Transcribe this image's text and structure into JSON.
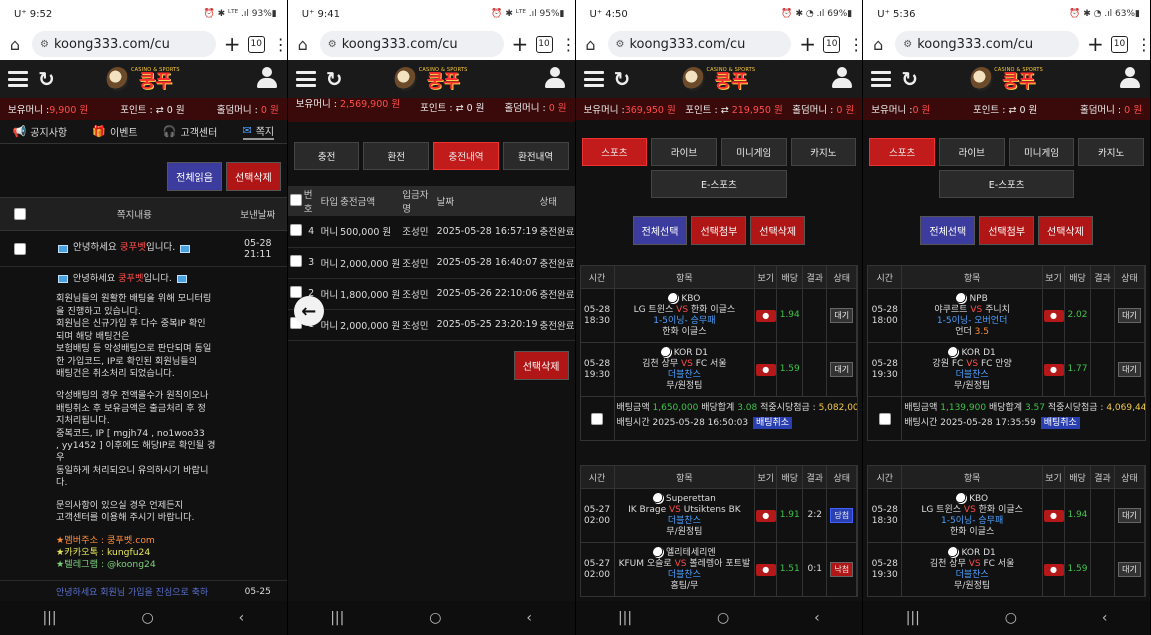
{
  "common": {
    "url": "koong333.com/cu",
    "tab_count": "10",
    "logo_small": "CASINO & SPORTS",
    "logo_big": "쿵푸",
    "labels": {
      "balance": "보유머니 :",
      "point": "포인트 :",
      "hold": "홀덤머니 :"
    },
    "point_icon": "⇄",
    "hold_value": "0 원"
  },
  "phones": [
    {
      "status": {
        "carrier": "U⁺",
        "time": "9:52",
        "right": "⏰ ✱ ᴸᵀᴱ .ıl 93%▮"
      },
      "balance": "9,900 원",
      "point": "0 원",
      "nav": [
        {
          "icon": "📢",
          "label": "공지사항"
        },
        {
          "icon": "🎁",
          "label": "이벤트"
        },
        {
          "icon": "🎧",
          "label": "고객센터"
        },
        {
          "icon": "✉",
          "label": "쪽지"
        }
      ],
      "buttons": {
        "read_all": "전체읽음",
        "delete_sel": "선택삭제"
      },
      "table_head": {
        "content": "쪽지내용",
        "date": "보낸날짜"
      },
      "msg_title_pre": "안녕하세요",
      "msg_title_brand": "쿵푸벳",
      "msg_title_post": "입니다.",
      "msg_date": "05-28",
      "msg_time": "21:11",
      "body_lines": [
        "회원님들의 원활한 배팅을 위해 모니터링",
        "을 진행하고 있습니다.",
        "회원님은 신규가입 후 다수 중복IP 확인",
        "되며 해당 배팅건은",
        "보험배팅 등 악성배팅으로 판단되며 동일",
        "한 가입코드, IP로 확인된 회원님들의",
        "배팅건은 취소처리 되었습니다."
      ],
      "body_lines2": [
        "악성배팅의 경우 전액몰수가 원칙이오나",
        "배팅취소 후 보유금액은 출금처리 후 정",
        "지처리됩니다.",
        "중복코드, IP [ mgjh74 , no1woo33",
        ", yy1452 ] 이후에도 해당IP로 확인될 경",
        "우",
        "동일하게 처리되오니 유의하시기 바랍니",
        "다."
      ],
      "body_lines3": [
        "문의사항이 있으실 경우 언제든지",
        "고객센터를 이용해 주시기 바랍니다."
      ],
      "contacts": [
        {
          "prefix": "★멤버주소 : ",
          "value": "쿵푸벳.com",
          "cls": "ln-o"
        },
        {
          "prefix": "★카카오톡 : ",
          "value": "kungfu24",
          "cls": "ln-y"
        },
        {
          "prefix": "★텔레그램 : ",
          "value": "@koong24",
          "cls": "ln-g"
        }
      ],
      "next_preview": "안녕하세요 회원님 가입을 진심으로 축하",
      "next_date": "05-25"
    },
    {
      "status": {
        "carrier": "U⁺",
        "time": "9:41",
        "right": "⏰ ✱ ᴸᵀᴱ .ıl 95%▮"
      },
      "balance": "2,569,900 원",
      "point": "0 원",
      "tabs": [
        "충전",
        "환전",
        "충전내역",
        "환전내역"
      ],
      "active_tab": 2,
      "txn_head": [
        "번호",
        "타입",
        "충전금액",
        "입금자명",
        "날짜",
        "상태"
      ],
      "txns": [
        {
          "no": "4",
          "type": "머니",
          "amount": "500,000 원",
          "name": "조성민",
          "date": "2025-05-28 16:57:19",
          "status": "충전완료"
        },
        {
          "no": "3",
          "type": "머니",
          "amount": "2,000,000 원",
          "name": "조성민",
          "date": "2025-05-28 16:40:07",
          "status": "충전완료"
        },
        {
          "no": "2",
          "type": "머니",
          "amount": "1,800,000 원",
          "name": "조성민",
          "date": "2025-05-26 22:10:06",
          "status": "충전완료"
        },
        {
          "no": "1",
          "type": "머니",
          "amount": "2,000,000 원",
          "name": "조성민",
          "date": "2025-05-25 23:20:19",
          "status": "충전완료"
        }
      ],
      "delete_btn": "선택삭제"
    },
    {
      "status": {
        "carrier": "U⁺",
        "time": "4:50",
        "right": "⏰ ✱ ◔ .ıl 69%▮"
      },
      "balance": "369,950 원",
      "point": "219,950 원"
    },
    {
      "status": {
        "carrier": "U⁺",
        "time": "5:36",
        "right": "⏰ ✱ ◔ .ıl 63%▮"
      },
      "balance": "0 원",
      "point": "0 원"
    }
  ],
  "betting": {
    "tabs": [
      "스포츠",
      "라이브",
      "미니게임",
      "카지노",
      "E-스포츠"
    ],
    "buttons": {
      "select_all": "전체선택",
      "attach": "선택첨부",
      "delete": "선택삭제"
    },
    "head": [
      "시간",
      "항목",
      "보기",
      "배당",
      "결과",
      "상태"
    ],
    "summary_labels": {
      "amount": "배팅금액",
      "odds": "배당합계",
      "win": "적중시당첨금 :",
      "time": "배팅시간",
      "cancel": "배팅취소"
    },
    "p3": {
      "slip1": {
        "rows": [
          {
            "date": "05-28",
            "time": "18:30",
            "league": "KBO",
            "home": "LG 트윈스",
            "away": "한화 이글스",
            "market": "1-5이닝- 승무패",
            "pick": "한화 이글스",
            "odds": "1.94",
            "result": "",
            "state": "대기"
          },
          {
            "date": "05-28",
            "time": "19:30",
            "league": "KOR D1",
            "home": "김천 상무",
            "away": "FC 서울",
            "market": "더블찬스",
            "pick": "무/원정팀",
            "odds": "1.59",
            "result": "",
            "state": "대기"
          }
        ],
        "amount": "1,650,000",
        "odds_total": "3.08",
        "win": "5,082,000",
        "time": "2025-05-28 16:50:03"
      },
      "slip2": {
        "rows": [
          {
            "date": "05-27",
            "time": "02:00",
            "league": "Superettan",
            "home": "IK Brage",
            "away": "Utsiktens BK",
            "market": "더블찬스",
            "pick": "무/원정팀",
            "odds": "1.91",
            "result": "2:2",
            "state": "당첨"
          },
          {
            "date": "05-27",
            "time": "02:00",
            "league": "엘리테세리엔",
            "home": "KFUM 오슬로",
            "away": "볼레렝아 포트발",
            "market": "더블찬스",
            "pick": "홈팀/무",
            "odds": "1.51",
            "result": "0:1",
            "state": "낙첨"
          }
        ]
      }
    },
    "p4": {
      "slip1": {
        "rows": [
          {
            "date": "05-28",
            "time": "18:00",
            "league": "NPB",
            "home": "야쿠르트",
            "away": "주니치",
            "market": "1-5이닝- 오버언더",
            "pick": "언더",
            "pick_extra": "3.5",
            "odds": "2.02",
            "result": "",
            "state": "대기"
          },
          {
            "date": "05-28",
            "time": "19:30",
            "league": "KOR D1",
            "home": "강원 FC",
            "away": "FC 안양",
            "market": "더블찬스",
            "pick": "무/원정팀",
            "odds": "1.77",
            "result": "",
            "state": "대기"
          }
        ],
        "amount": "1,139,900",
        "odds_total": "3.57",
        "win": "4,069,443",
        "time": "2025-05-28 17:35:59"
      },
      "slip2": {
        "rows": [
          {
            "date": "05-28",
            "time": "18:30",
            "league": "KBO",
            "home": "LG 트윈스",
            "away": "한화 이글스",
            "market": "1-5이닝- 승무패",
            "pick": "한화 이글스",
            "odds": "1.94",
            "result": "",
            "state": "대기"
          },
          {
            "date": "05-28",
            "time": "19:30",
            "league": "KOR D1",
            "home": "김천 상무",
            "away": "FC 서울",
            "market": "더블찬스",
            "pick": "무/원정팀",
            "odds": "1.59",
            "result": "",
            "state": "대기"
          }
        ]
      }
    },
    "vs": "VS"
  },
  "sysnav": [
    "|||",
    "○",
    "‹"
  ]
}
